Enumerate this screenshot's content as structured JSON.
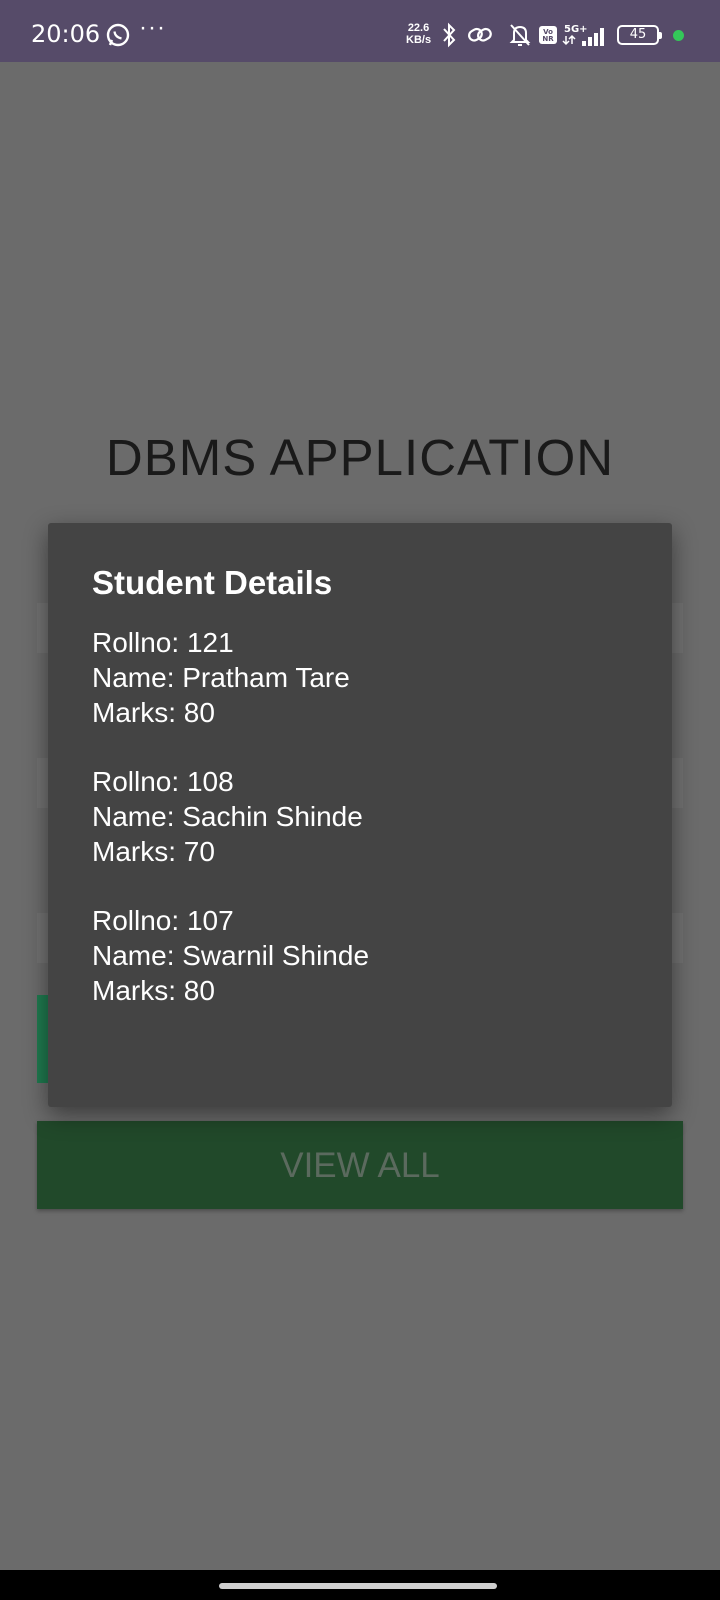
{
  "status_bar": {
    "time": "20:06",
    "more": "···",
    "network_speed_value": "22.6",
    "network_speed_unit": "KB/s",
    "battery": "45",
    "icons": [
      "whatsapp-icon",
      "bluetooth-icon",
      "link-icon",
      "bell-off-icon",
      "vonr-icon",
      "signal-5g-icon",
      "battery-icon",
      "privacy-dot-icon"
    ]
  },
  "app": {
    "title": "DBMS APPLICATION",
    "view_all_label": "VIEW ALL"
  },
  "dialog": {
    "title": "Student Details",
    "records": [
      {
        "rollno": "Rollno: 121",
        "name": "Name: Pratham Tare",
        "marks": "Marks: 80"
      },
      {
        "rollno": "Rollno: 108",
        "name": "Name: Sachin Shinde",
        "marks": "Marks: 70"
      },
      {
        "rollno": "Rollno: 107",
        "name": "Name: Swarnil Shinde",
        "marks": "Marks: 80"
      }
    ]
  },
  "colors": {
    "status_bar": "#564b69",
    "scrim_background": "#6b6b6b",
    "dialog_background": "#444444",
    "button_green": "#21492a",
    "accent_green": "#1f7a4f"
  }
}
